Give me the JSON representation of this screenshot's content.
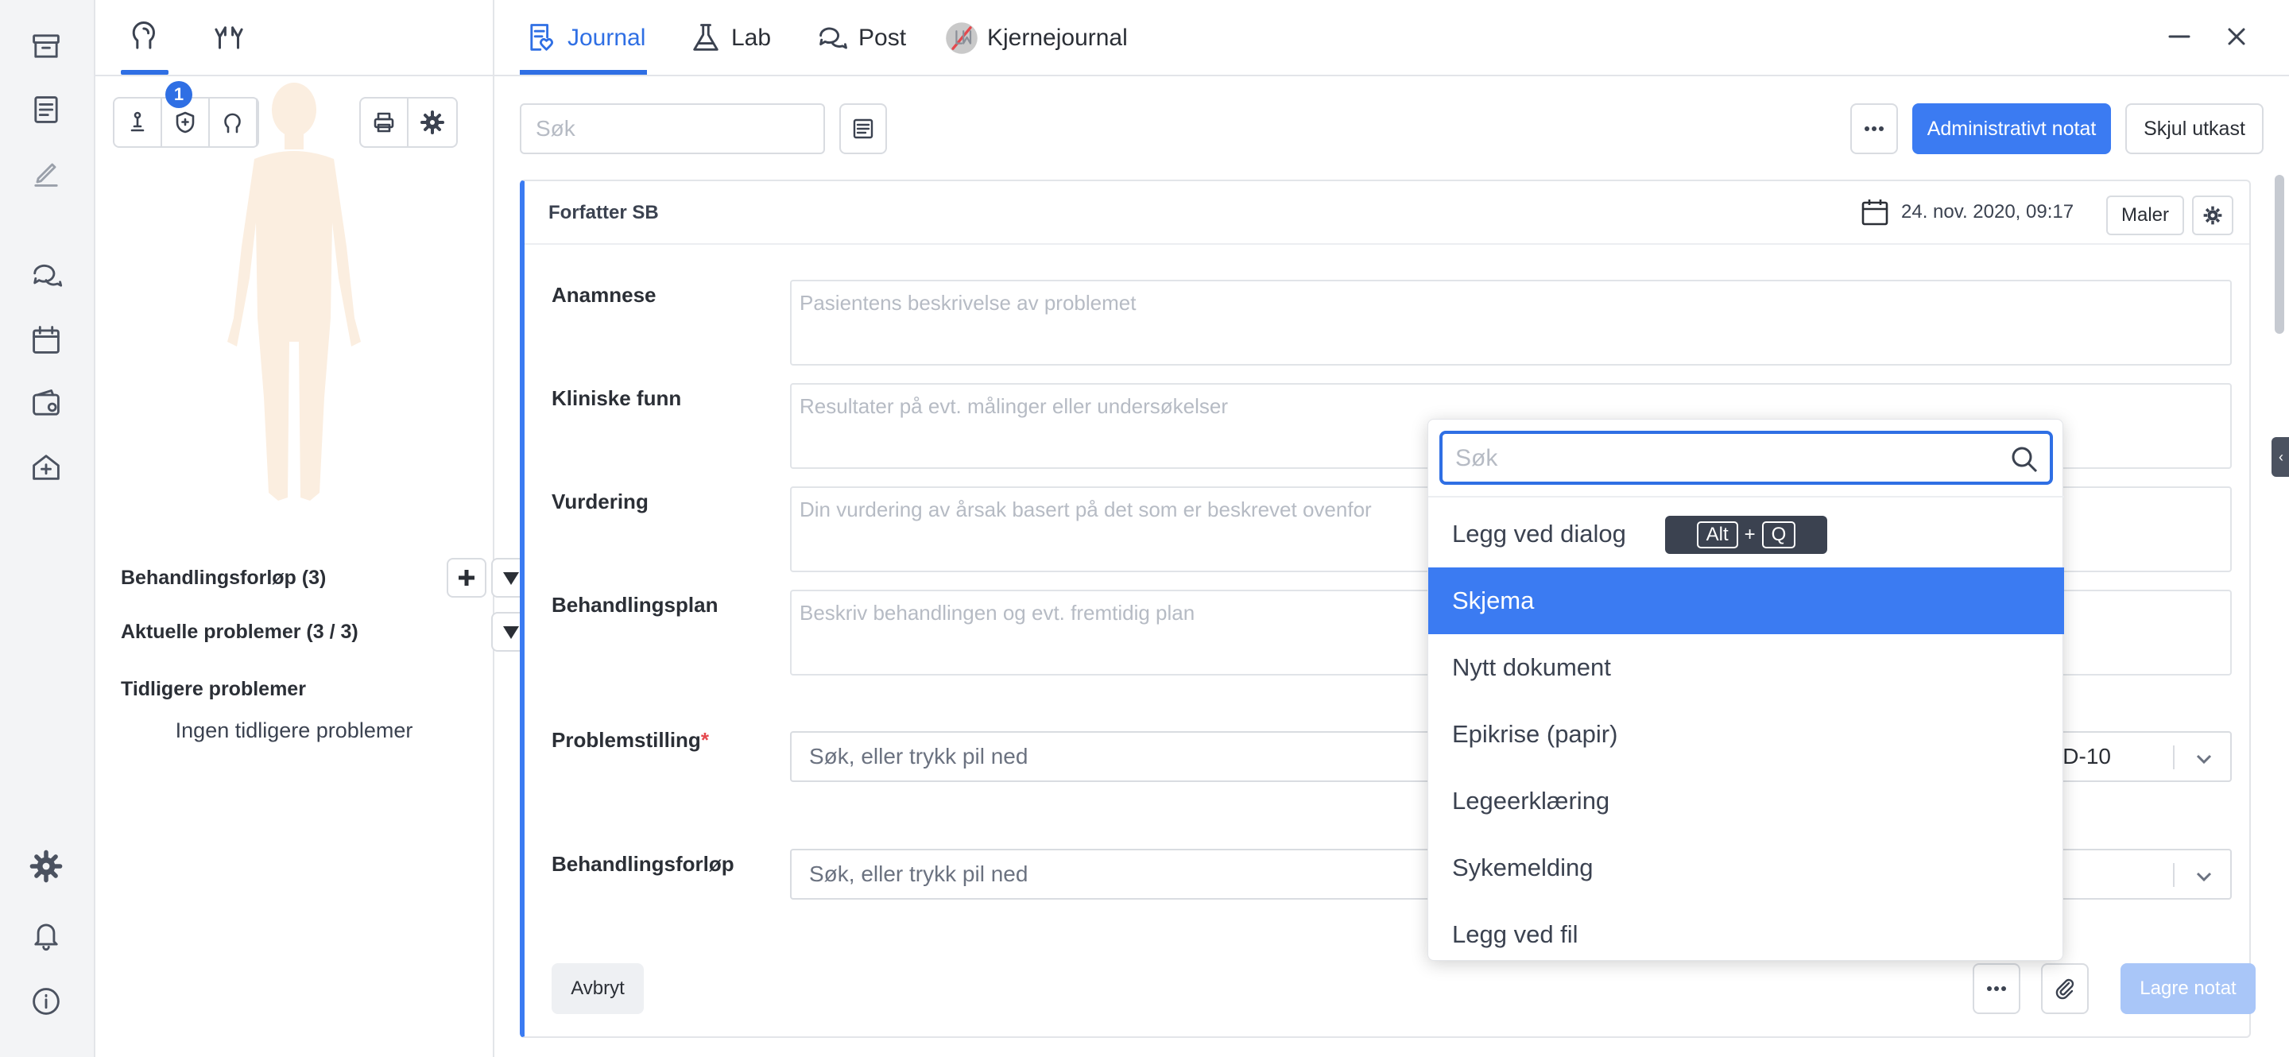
{
  "rail": {
    "items": [
      "archive-icon",
      "document-icon",
      "pen-icon",
      "chat-icon",
      "calendar-icon",
      "wallet-icon",
      "clinic-icon",
      "settings-icon",
      "bell-icon",
      "info-icon"
    ]
  },
  "patient_panel": {
    "tab_icons": [
      "head-icon",
      "hands-icon"
    ],
    "badge_count": "1",
    "behandlingsforlop_label": "Behandlingsforløp (3)",
    "aktuelle_label": "Aktuelle problemer (3 / 3)",
    "tidligere_label": "Tidligere problemer",
    "tidligere_empty": "Ingen tidligere problemer"
  },
  "tabs": [
    {
      "label": "Journal",
      "icon": "journal-icon",
      "active": true
    },
    {
      "label": "Lab",
      "icon": "flask-icon",
      "active": false
    },
    {
      "label": "Post",
      "icon": "post-icon",
      "active": false
    },
    {
      "label": "Kjernejournal",
      "icon": "kjernejournal-icon",
      "active": false
    }
  ],
  "toolbar": {
    "search_placeholder": "Søk",
    "admin_note_label": "Administrativt notat",
    "hide_draft_label": "Skjul utkast"
  },
  "note": {
    "author": "Forfatter SB",
    "date": "24. nov. 2020, 09:17",
    "templates_label": "Maler",
    "fields": [
      {
        "label": "Anamnese",
        "placeholder": "Pasientens beskrivelse av problemet"
      },
      {
        "label": "Kliniske funn",
        "placeholder": "Resultater på evt. målinger eller undersøkelser"
      },
      {
        "label": "Vurdering",
        "placeholder": "Din vurdering av årsak basert på det som er beskrevet ovenfor"
      },
      {
        "label": "Behandlingsplan",
        "placeholder": "Beskriv behandlingen og evt. fremtidig plan"
      }
    ],
    "problemstilling_label": "Problemstilling",
    "problemstilling_required": "*",
    "problemstilling_placeholder": "Søk, eller trykk pil ned",
    "icd_value": "D-10",
    "behandlingsforlop_label": "Behandlingsforløp",
    "behandlingsforlop_placeholder": "Søk, eller trykk pil ned",
    "cancel_label": "Avbryt",
    "save_label": "Lagre notat"
  },
  "menu": {
    "search_placeholder": "Søk",
    "items": [
      "Legg ved dialog",
      "Skjema",
      "Nytt dokument",
      "Epikrise (papir)",
      "Legeerklæring",
      "Sykemelding",
      "Legg ved fil"
    ],
    "selected": "Skjema",
    "shortcut_key1": "Alt",
    "shortcut_plus": "+",
    "shortcut_key2": "Q"
  },
  "colors": {
    "accent": "#3b7bf2",
    "active_tab": "#2f6fe4",
    "body_figure": "#fbeee0",
    "required": "#e5484d"
  }
}
